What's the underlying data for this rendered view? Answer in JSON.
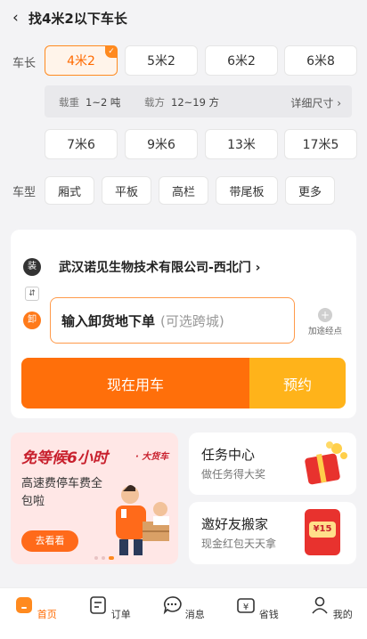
{
  "header": {
    "title": "找4米2以下车长",
    "back_icon": "‹"
  },
  "vehicle_length": {
    "label": "车长",
    "options_row1": [
      "4米2",
      "5米2",
      "6米2",
      "6米8"
    ],
    "options_row2": [
      "7米6",
      "9米6",
      "13米",
      "17米5"
    ],
    "selected": "4米2",
    "spec": {
      "load_label": "载重",
      "load_value": "1~2 吨",
      "volume_label": "载方",
      "volume_value": "12~19 方",
      "detail_link": "详细尺寸 ›"
    }
  },
  "vehicle_type": {
    "label": "车型",
    "options": [
      "厢式",
      "平板",
      "高栏",
      "带尾板",
      "更多"
    ]
  },
  "order_card": {
    "load_badge": "装",
    "load_address": "武汉诺见生物技术有限公司-西北门 ›",
    "swap_icon": "⇵",
    "unload_badge": "卸",
    "unload_main": "输入卸货地下单",
    "unload_hint": "(可选跨城)",
    "waypoint_label": "加途经点",
    "now_button": "现在用车",
    "book_button": "预约"
  },
  "promo": {
    "title": "免等候6小时",
    "tag": "· 大货车",
    "subtitle": "高速费停车费全包啦",
    "cta": "去看看"
  },
  "task_card": {
    "title": "任务中心",
    "subtitle": "做任务得大奖"
  },
  "invite_card": {
    "title": "邀好友搬家",
    "subtitle": "现金红包天天拿",
    "badge": "¥15"
  },
  "tabbar": [
    {
      "label": "首页",
      "icon": "home-icon",
      "active": true
    },
    {
      "label": "订单",
      "icon": "order-icon",
      "active": false
    },
    {
      "label": "消息",
      "icon": "message-icon",
      "active": false
    },
    {
      "label": "省钱",
      "icon": "coupon-icon",
      "active": false
    },
    {
      "label": "我的",
      "icon": "profile-icon",
      "active": false
    }
  ],
  "colors": {
    "accent": "#ff6f0a",
    "accent_light": "#ffb31a",
    "promo_red": "#c8202d"
  }
}
